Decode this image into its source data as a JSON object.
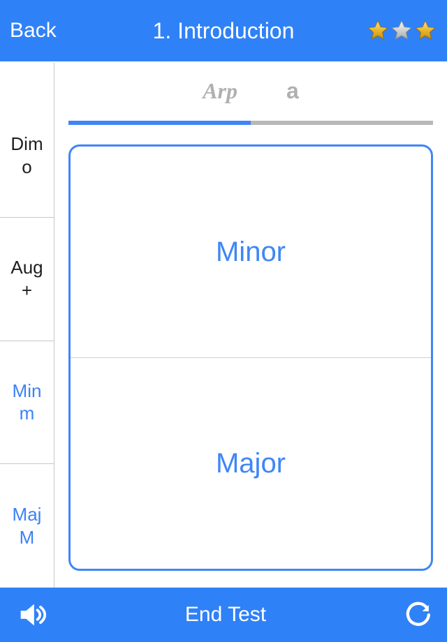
{
  "header": {
    "back_label": "Back",
    "title": "1. Introduction",
    "stars": [
      "gold",
      "silver",
      "gold"
    ]
  },
  "sidebar": {
    "items": [
      {
        "line1": "Dim",
        "line2": "o",
        "active": false
      },
      {
        "line1": "Aug",
        "line2": "+",
        "active": false
      },
      {
        "line1": "Min",
        "line2": "m",
        "active": true
      },
      {
        "line1": "Maj",
        "line2": "M",
        "active": true
      }
    ]
  },
  "main": {
    "tabs": {
      "arp": "Arp",
      "a": "a"
    },
    "progress_percent": 50,
    "options": [
      {
        "label": "Minor"
      },
      {
        "label": "Major"
      }
    ]
  },
  "footer": {
    "end_label": "End Test"
  }
}
